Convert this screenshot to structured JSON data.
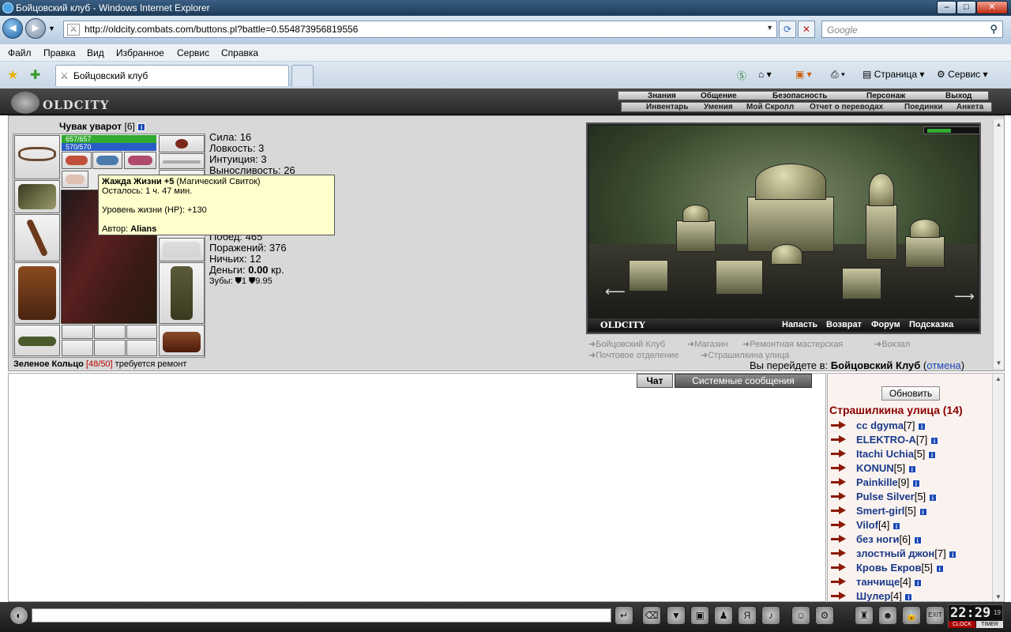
{
  "window": {
    "title": "Бойцовский клуб - Windows Internet Explorer"
  },
  "address": {
    "url": "http://oldcity.combats.com/buttons.pl?battle=0.554873956819556",
    "search_placeholder": "Google"
  },
  "menu": [
    "Файл",
    "Правка",
    "Вид",
    "Избранное",
    "Сервис",
    "Справка"
  ],
  "tab": {
    "label": "Бойцовский клуб"
  },
  "toolbar": {
    "page": "Страница",
    "tools": "Сервис"
  },
  "game": {
    "logo": "OLDCITY",
    "top_menu": [
      "Знания",
      "Общение",
      "Безопасность",
      "Персонаж",
      "Выход"
    ],
    "sub_menu": [
      "Инвентарь",
      "Умения",
      "Мой Скролл",
      "Отчет о переводах",
      "Поединки",
      "Анкета"
    ]
  },
  "character": {
    "name": "Чувак уварот",
    "level": "[6]",
    "hp": "657/657",
    "mana": "570/570",
    "stats": {
      "strength": "Сила: 16",
      "agility": "Ловкость: 3",
      "intuition": "Интуиция: 3",
      "endurance": "Выносливость: 26",
      "wins": "Побед: 465",
      "losses": "Поражений: 376",
      "draws": "Ничьих: 12",
      "money_label": "Деньги:",
      "money_value": "0.00",
      "money_unit": "кр.",
      "teeth_label": "Зубы:",
      "teeth_1": "1",
      "teeth_2": "9.95"
    },
    "item_status": {
      "name": "Зеленое Кольцо",
      "durability": "[48/50]",
      "note": "требуется ремонт"
    }
  },
  "tooltip": {
    "title": "Жажда Жизни +5",
    "type": "(Магический Свиток)",
    "remaining": "Осталось: 1 ч. 47 мин.",
    "effect": "Уровень жизни (HP): +130",
    "author_label": "Автор:",
    "author": "Alians"
  },
  "scene": {
    "caption": "OLDCITY",
    "actions": [
      "Напасть",
      "Возврат",
      "Форум",
      "Подсказка"
    ],
    "locations": [
      "Бойцовский Клуб",
      "Магазин",
      "Ремонтная мастерская",
      "Вокзал",
      "Почтовое отделение",
      "Страшилкина улица"
    ],
    "goto_text": "Вы перейдете в:",
    "goto_target": "Бойцовский Клуб",
    "cancel": "отмена"
  },
  "chat": {
    "tab_chat": "Чат",
    "tab_system": "Системные сообщения"
  },
  "room": {
    "refresh": "Обновить",
    "title": "Страшилкина улица (14)",
    "users": [
      {
        "name": "cc dgyma",
        "level": "[7]"
      },
      {
        "name": "ELEKTRO-A",
        "level": "[7]"
      },
      {
        "name": "Itachi Uchia",
        "level": "[5]"
      },
      {
        "name": "KONUN",
        "level": "[5]"
      },
      {
        "name": "Painkille",
        "level": "[9]"
      },
      {
        "name": "Pulse Silver",
        "level": "[5]"
      },
      {
        "name": "Smert-girl",
        "level": "[5]"
      },
      {
        "name": "Vilof",
        "level": "[4]"
      },
      {
        "name": "без ноги",
        "level": "[6]"
      },
      {
        "name": "злостный джон",
        "level": "[7]"
      },
      {
        "name": "Кровь Екров",
        "level": "[5]"
      },
      {
        "name": "танчище",
        "level": "[4]"
      },
      {
        "name": "Шулер",
        "level": "[4]"
      }
    ]
  },
  "clock": {
    "time": "22:29",
    "seconds": "19",
    "label_clock": "CLOCK",
    "label_timer": "TIMER"
  }
}
